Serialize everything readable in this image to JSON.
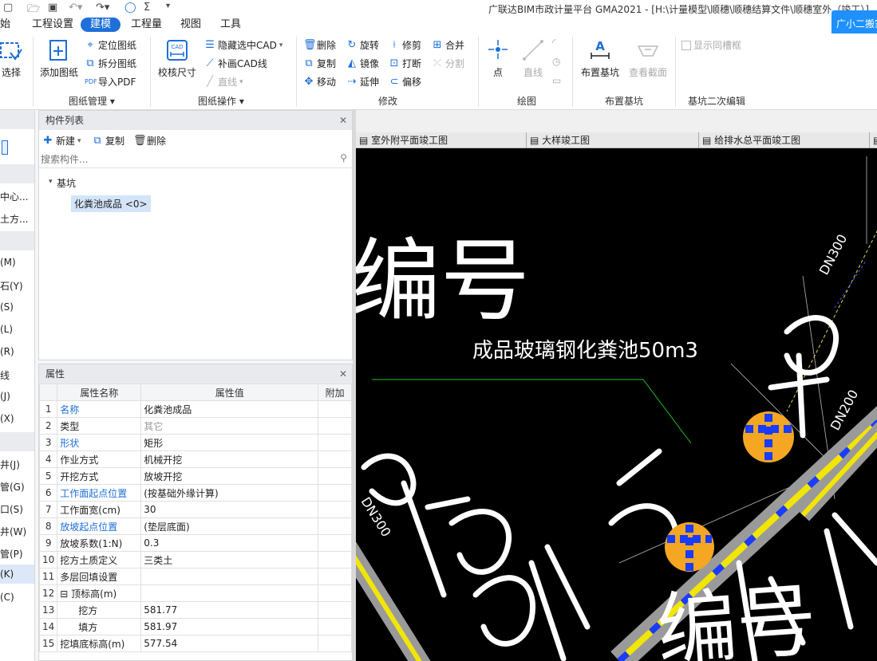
{
  "app": {
    "title": "广联达BIM市政计量平台 GMA2021 - [H:\\计量模型\\顺穗\\顺穗结算文件\\顺穗室外（竣工）]",
    "help_button": "广小二搬家"
  },
  "menus": [
    {
      "label": "始",
      "active": false
    },
    {
      "label": "工程设置",
      "active": false
    },
    {
      "label": "建模",
      "active": true
    },
    {
      "label": "工程量",
      "active": false
    },
    {
      "label": "视图",
      "active": false
    },
    {
      "label": "工具",
      "active": false
    }
  ],
  "ribbon": {
    "select_label": "选择",
    "add_drawing": "添加图纸",
    "locate_drawing": "定位图纸",
    "split_drawing": "拆分图纸",
    "import_pdf": "导入PDF",
    "group_drawing_mgmt": "图纸管理",
    "check_size": "校核尺寸",
    "hide_cad": "隐藏选中CAD",
    "draw_cad_line": "补画CAD线",
    "line": "直线",
    "group_drawing_ops": "图纸操作",
    "delete": "删除",
    "rotate": "旋转",
    "trim": "修剪",
    "merge": "合并",
    "copy": "复制",
    "mirror": "镜像",
    "break": "打断",
    "split": "分割",
    "move": "移动",
    "extend": "延伸",
    "offset": "偏移",
    "group_modify": "修改",
    "point": "点",
    "straight": "直线",
    "group_draw": "绘图",
    "place_pit": "布置基坑",
    "view_section": "查看截面",
    "group_place_pit": "布置基坑",
    "show_trough": "显示同槽框",
    "group_pit_edit": "基坑二次编辑"
  },
  "leftnav": {
    "items": [
      "中心...",
      "土方...",
      "(M)",
      "石(Y)",
      "(S)",
      "(L)",
      "(R)",
      "线",
      "(J)",
      "(X)",
      "井(J)",
      "管(G)",
      "口(S)",
      "井(W)",
      "管(P)",
      "(K)",
      "(C)"
    ]
  },
  "components": {
    "panel_title": "构件列表",
    "new": "新建",
    "copy": "复制",
    "delete": "删除",
    "search_placeholder": "搜索构件...",
    "tree_root": "基坑",
    "tree_item": "化粪池成品 <0>"
  },
  "properties": {
    "panel_title": "属性",
    "col_name": "属性名称",
    "col_value": "属性值",
    "col_extra": "附加",
    "rows": [
      {
        "n": "1",
        "k": "名称",
        "v": "化粪池成品",
        "kc": "blue",
        "vc": ""
      },
      {
        "n": "2",
        "k": "类型",
        "v": "其它",
        "kc": "",
        "vc": "gray"
      },
      {
        "n": "3",
        "k": "形状",
        "v": "矩形",
        "kc": "blue",
        "vc": ""
      },
      {
        "n": "4",
        "k": "作业方式",
        "v": "机械开挖",
        "kc": "",
        "vc": ""
      },
      {
        "n": "5",
        "k": "开挖方式",
        "v": "放坡开挖",
        "kc": "",
        "vc": ""
      },
      {
        "n": "6",
        "k": "工作面起点位置",
        "v": "(按基础外缘计算)",
        "kc": "blue",
        "vc": ""
      },
      {
        "n": "7",
        "k": "工作面宽(cm)",
        "v": "30",
        "kc": "",
        "vc": ""
      },
      {
        "n": "8",
        "k": "放坡起点位置",
        "v": "(垫层底面)",
        "kc": "blue",
        "vc": ""
      },
      {
        "n": "9",
        "k": "放坡系数(1:N)",
        "v": "0.3",
        "kc": "",
        "vc": ""
      },
      {
        "n": "10",
        "k": "挖方土质定义",
        "v": "三类土",
        "kc": "",
        "vc": ""
      },
      {
        "n": "11",
        "k": "多层回填设置",
        "v": "",
        "kc": "",
        "vc": ""
      },
      {
        "n": "12",
        "k": "⊟ 顶标高(m)",
        "v": "",
        "kc": "",
        "vc": ""
      },
      {
        "n": "13",
        "k": "挖方",
        "v": "581.77",
        "kc": "",
        "vc": "",
        "indent": true
      },
      {
        "n": "14",
        "k": "填方",
        "v": "581.97",
        "kc": "",
        "vc": "",
        "indent": true
      },
      {
        "n": "15",
        "k": "挖填底标高(m)",
        "v": "577.54",
        "kc": "",
        "vc": ""
      }
    ]
  },
  "canvas_tabs": [
    "室外附平面竣工图",
    "大样竣工图",
    "给排水总平面竣工图"
  ],
  "cad": {
    "big_text_1": "编号",
    "note": "成品玻璃钢化粪池50m3",
    "dn300_a": "DN300",
    "dn200": "DN200",
    "dn300_b": "DN300",
    "big_text_2": "编号"
  },
  "colors": {
    "accent": "#1e6fd9",
    "help": "#1e90ff",
    "pipe_yellow": "#f2e600",
    "pipe_blue": "#1a3cff",
    "node_orange": "#f5a623"
  }
}
